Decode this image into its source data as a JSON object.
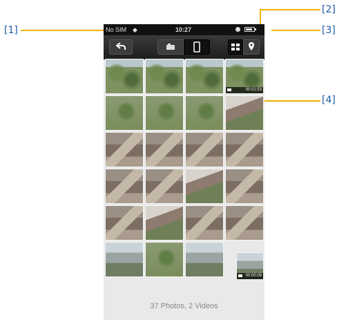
{
  "callouts": {
    "c1": "[1]",
    "c2": "[2]",
    "c3": "[3]",
    "c4": "[4]"
  },
  "status_bar": {
    "carrier": "No SIM",
    "time": "10:27"
  },
  "toolbar": {
    "back_icon": "back-arrow-icon",
    "camera_icon": "camera-icon",
    "phone_icon": "phone-icon",
    "grid_icon": "grid-icon",
    "map_icon": "map-pin-icon"
  },
  "videos": [
    {
      "duration": "00:02:53"
    },
    {
      "duration": "00:00:09"
    }
  ],
  "footer": {
    "count": "37 Photos, 2 Videos"
  },
  "colors": {
    "callout_line": "#f0b400",
    "callout_text": "#1c5aa6",
    "toolbar": "#2a2a2a"
  }
}
